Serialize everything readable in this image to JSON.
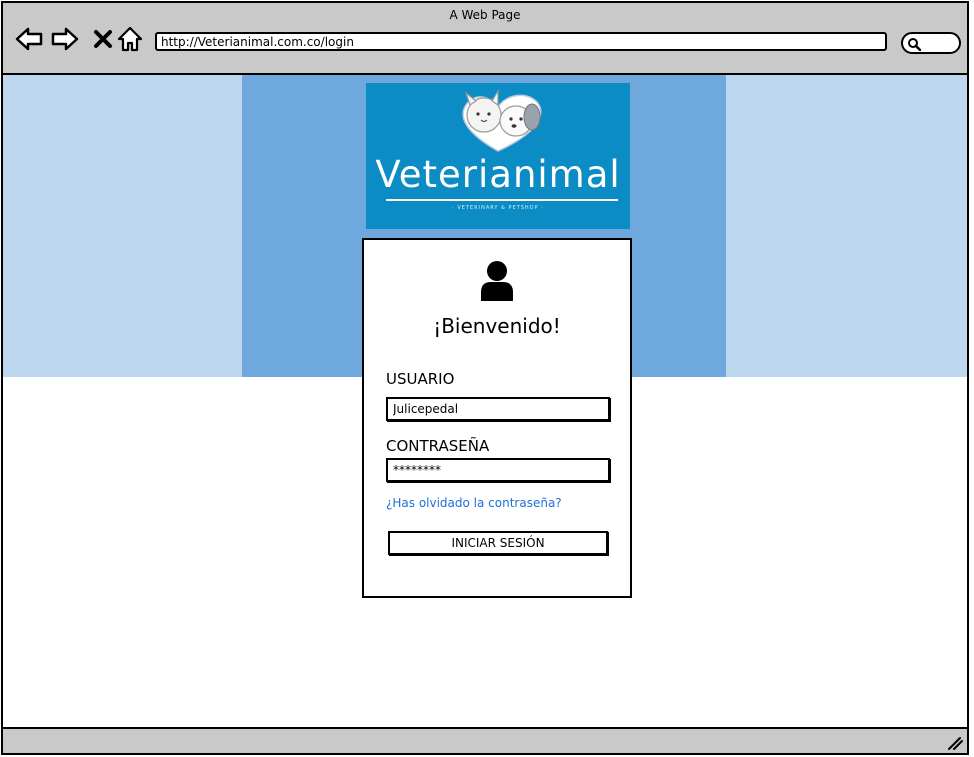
{
  "window": {
    "title": "A Web Page",
    "url": "http://Veterianimal.com.co/login"
  },
  "logo": {
    "name": "Veterianimal",
    "tagline": "· VETERINARY & PETSHOP ·"
  },
  "login": {
    "welcome": "¡Bienvenido!",
    "username_label": "USUARIO",
    "username_value": "Julicepedal",
    "password_label": "CONTRASEÑA",
    "password_value": "********",
    "forgot_link": "¿Has olvidado la contraseña?",
    "submit_label": "INICIAR SESIÓN"
  },
  "colors": {
    "hero_band": "#bdd7ee",
    "hero_center": "#6fa8dc",
    "logo_bg": "#0c8cc4",
    "link": "#1e6fd9",
    "chrome": "#c9c9c9"
  },
  "icons": [
    "back-arrow-icon",
    "forward-arrow-icon",
    "close-icon",
    "home-icon",
    "search-icon",
    "user-icon",
    "resize-handle-icon"
  ]
}
